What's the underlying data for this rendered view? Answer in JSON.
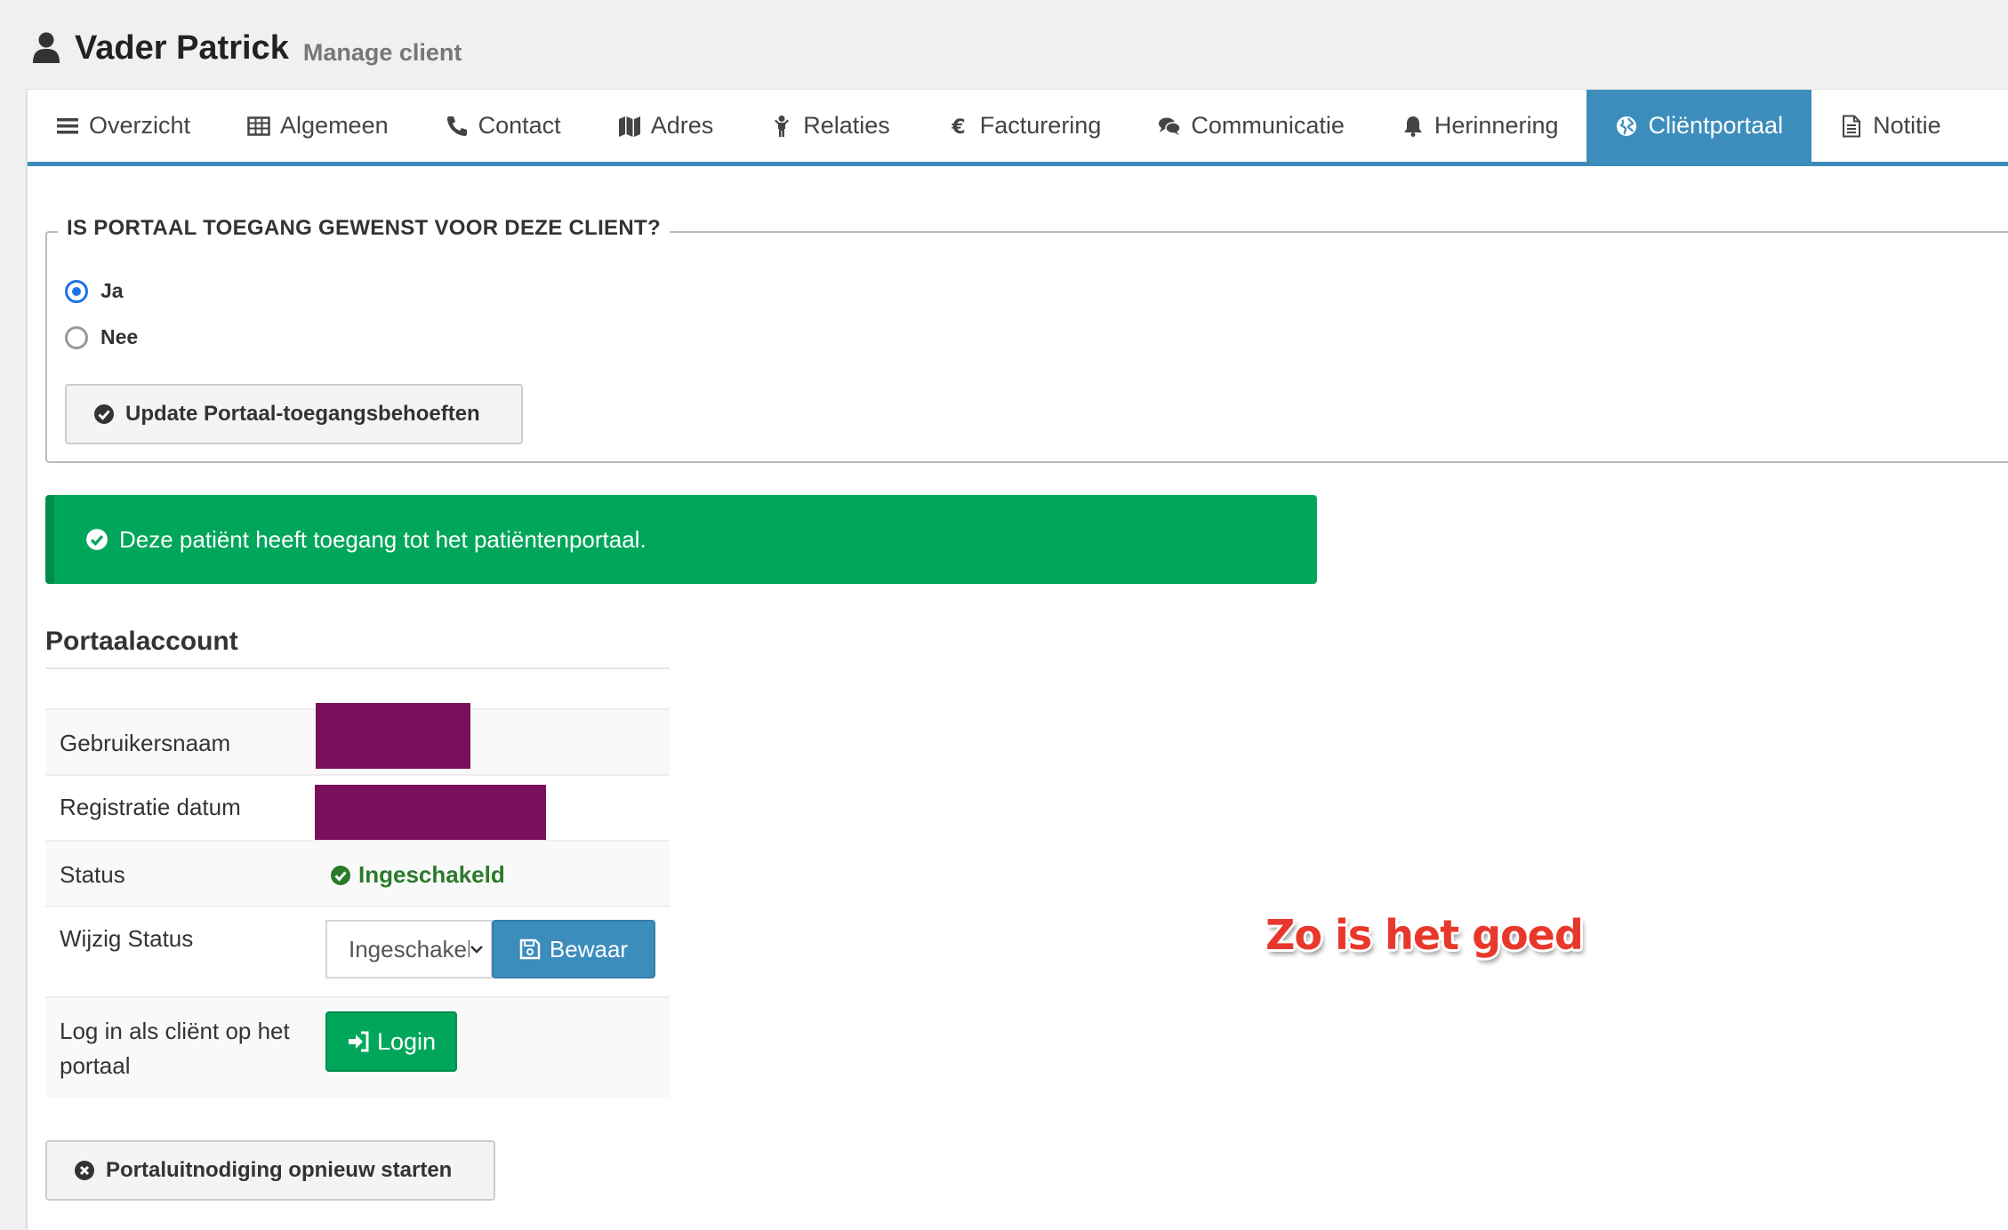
{
  "header": {
    "title": "Vader Patrick",
    "subtitle": "Manage client"
  },
  "tabs": [
    {
      "label": "Overzicht",
      "icon": "bars-icon"
    },
    {
      "label": "Algemeen",
      "icon": "table-icon"
    },
    {
      "label": "Contact",
      "icon": "phone-icon"
    },
    {
      "label": "Adres",
      "icon": "map-icon"
    },
    {
      "label": "Relaties",
      "icon": "child-icon"
    },
    {
      "label": "Facturering",
      "icon": "euro-icon"
    },
    {
      "label": "Communicatie",
      "icon": "comments-icon"
    },
    {
      "label": "Herinnering",
      "icon": "bell-icon"
    },
    {
      "label": "Cliëntportaal",
      "icon": "globe-icon",
      "active": true
    },
    {
      "label": "Notitie",
      "icon": "file-text-icon"
    }
  ],
  "portal_access": {
    "legend": "IS PORTAAL TOEGANG GEWENST VOOR DEZE CLIENT?",
    "options": [
      {
        "label": "Ja",
        "checked": true
      },
      {
        "label": "Nee",
        "checked": false
      }
    ],
    "update_button": "Update Portaal-toegangsbehoeften"
  },
  "alert": {
    "text": "Deze patiënt heeft toegang tot het patiëntenportaal.",
    "color": "#00a65a"
  },
  "account": {
    "title": "Portaalaccount",
    "username_label": "Gebruikersnaam",
    "registration_label": "Registratie datum",
    "status_label": "Status",
    "status_value": "Ingeschakeld",
    "change_status_label": "Wijzig Status",
    "status_select_value": "Ingeschakeld",
    "save_button": "Bewaar",
    "login_label": "Log in als cliënt op het portaal",
    "login_button": "Login"
  },
  "restart_button": "Portaluitnodiging opnieuw starten",
  "annotation": "Zo is het goed",
  "colors": {
    "accent": "#3c8dbc",
    "success": "#00a65a",
    "redaction": "#7a0f5c",
    "annotation": "#e8382b"
  }
}
